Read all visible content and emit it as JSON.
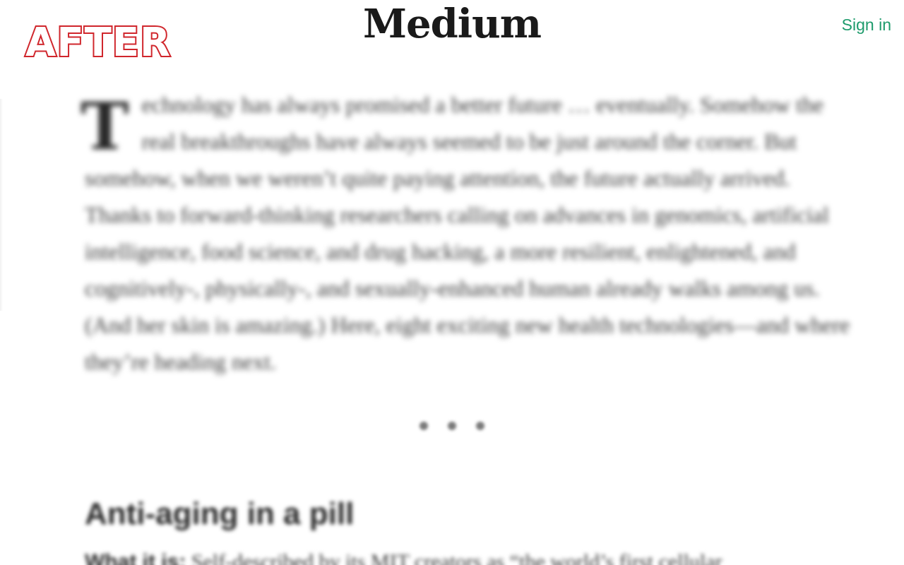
{
  "header": {
    "publication_logo": "AFTER",
    "site_logo": "Medium",
    "sign_in_label": "Sign in"
  },
  "article": {
    "drop_cap": "T",
    "intro_rest": "echnology has always promised a better future … eventually. Somehow the real breakthroughs have always seemed to be just around the corner. But somehow, when we weren’t quite paying attention, the future actually arrived. Thanks to forward-thinking researchers calling on advances in genomics, artificial intelligence, food science, and drug hacking, a more resilient, enlightened, and cognitively-, physically-, and sexually-enhanced human already walks among us. (And her skin is amazing.) Here, eight exciting new health technologies—and where they’re heading next.",
    "section_heading": "Anti-aging in a pill",
    "next_lead_in": "What it is:",
    "next_text": " Self-described by its MIT creators as “the world’s first cellular"
  },
  "colors": {
    "accent_green": "#1e9b6c",
    "logo_red": "#d0262c"
  }
}
